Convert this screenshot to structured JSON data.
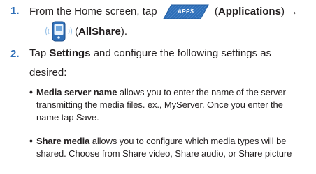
{
  "steps": [
    {
      "number": "1.",
      "line1_before": "From the Home screen, tap",
      "apps_icon_label": "APPS",
      "line1_paren_open": "(",
      "line1_bold": "Applications",
      "line1_after": ") →",
      "line2_paren_open": "(",
      "line2_bold": "AllShare",
      "line2_after": ")."
    },
    {
      "number": "2.",
      "line1_before": "Tap ",
      "line1_bold": "Settings",
      "line1_after": " and configure the following settings as",
      "line2": "desired:"
    }
  ],
  "bullets": [
    {
      "term": "Media server name",
      "lines": [
        " allows you to enter the name of the server",
        "transmitting the media files. ex., MyServer. Once you enter the",
        "name tap Save."
      ]
    },
    {
      "term": "Share media",
      "lines": [
        " allows you to configure which media types will be",
        "shared. Choose from Share video, Share audio, or Share picture"
      ]
    }
  ],
  "colors": {
    "step_number": "#2f6fb8",
    "apps_button": "#2f6fb8",
    "text": "#231f20"
  },
  "icons": [
    "apps-icon",
    "allshare-icon",
    "arrow-right"
  ]
}
